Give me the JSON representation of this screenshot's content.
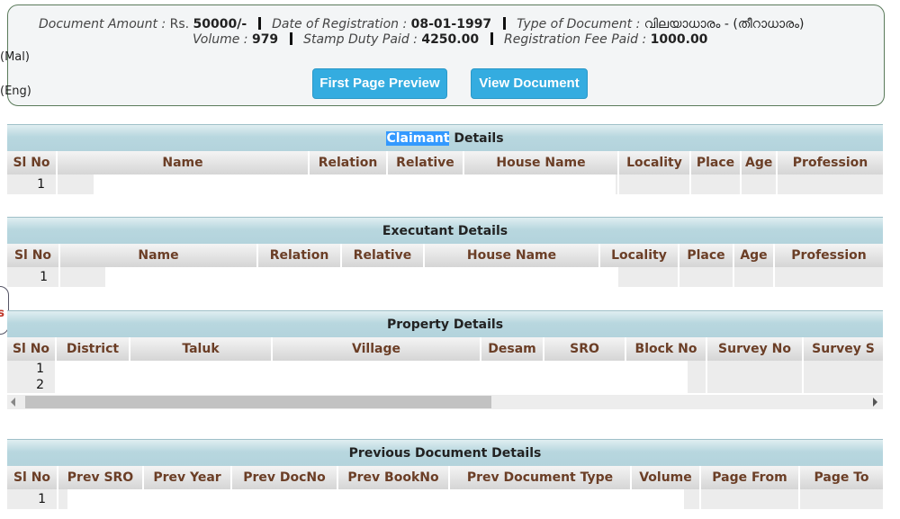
{
  "summary": {
    "line1": [
      {
        "label": "Document Amount : ",
        "plain": "Rs. ",
        "value": "50000/-"
      },
      {
        "label": "Date of Registration : ",
        "plain": "",
        "value": "08-01-1997"
      },
      {
        "label": "Type of Document : ",
        "plain": "വിലയാധാരം - (തീറാധാരം)",
        "value": ""
      }
    ],
    "line2": [
      {
        "label": "Volume : ",
        "plain": "",
        "value": "979"
      },
      {
        "label": "Stamp Duty Paid : ",
        "plain": "",
        "value": "4250.00"
      },
      {
        "label": "Registration Fee Paid : ",
        "plain": "",
        "value": "1000.00"
      }
    ],
    "side_mal": "(Mal)",
    "side_eng": "(Eng)",
    "first_page_preview_label": "First Page Preview",
    "view_document_label": "View Document"
  },
  "left_tab_fragment": "s",
  "claimant": {
    "title_highlight": "Claimant",
    "title_rest": " Details",
    "columns": [
      "Sl No",
      "Name",
      "Relation",
      "Relative",
      "House Name",
      "Locality",
      "Place",
      "Age",
      "Profession"
    ],
    "rows": [
      [
        "1",
        "",
        "",
        "",
        "",
        "",
        "",
        "",
        ""
      ]
    ]
  },
  "executant": {
    "title": "Executant Details",
    "columns": [
      "Sl No",
      "Name",
      "Relation",
      "Relative",
      "House Name",
      "Locality",
      "Place",
      "Age",
      "Profession"
    ],
    "rows": [
      [
        "1",
        "",
        "",
        "",
        "",
        "",
        "",
        "",
        ""
      ]
    ]
  },
  "property": {
    "title": "Property Details",
    "columns": [
      "Sl No",
      "District",
      "Taluk",
      "Village",
      "Desam",
      "SRO",
      "Block No",
      "Survey No",
      "Survey S"
    ],
    "rows": [
      [
        "1",
        "",
        "",
        "",
        "",
        "",
        "",
        "",
        ""
      ],
      [
        "2",
        "",
        "",
        "",
        "",
        "",
        "",
        "",
        ""
      ]
    ]
  },
  "previous_document": {
    "title": "Previous Document Details",
    "columns": [
      "Sl No",
      "Prev SRO",
      "Prev Year",
      "Prev DocNo",
      "Prev BookNo",
      "Prev Document Type",
      "Volume",
      "Page From",
      "Page To"
    ],
    "rows": [
      [
        "1",
        "",
        "",
        "",
        "",
        "",
        "",
        "",
        ""
      ]
    ]
  }
}
